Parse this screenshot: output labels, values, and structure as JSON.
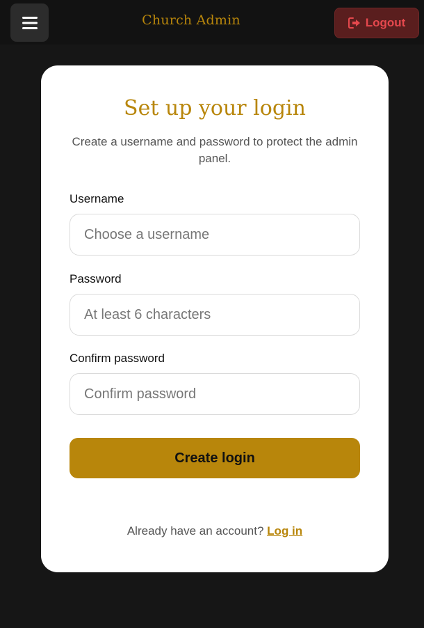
{
  "header": {
    "brand": "Church Admin",
    "logout_label": "Logout",
    "menu_icon": "hamburger-icon",
    "logout_icon": "sign-out-icon"
  },
  "form": {
    "title": "Set up your login",
    "subtitle": "Create a username and password to protect the admin panel.",
    "username": {
      "label": "Username",
      "placeholder": "Choose a username",
      "value": ""
    },
    "password": {
      "label": "Password",
      "placeholder": "At least 6 characters",
      "value": ""
    },
    "confirm": {
      "label": "Confirm password",
      "placeholder": "Confirm password",
      "value": ""
    },
    "submit_label": "Create login",
    "footer_prompt": "Already have an account?",
    "footer_link": "Log in"
  },
  "colors": {
    "background": "#161616",
    "accent_gold": "#b8860b",
    "logout_bg": "#5a1e1e",
    "logout_text": "#e5484d",
    "card": "#ffffff"
  }
}
